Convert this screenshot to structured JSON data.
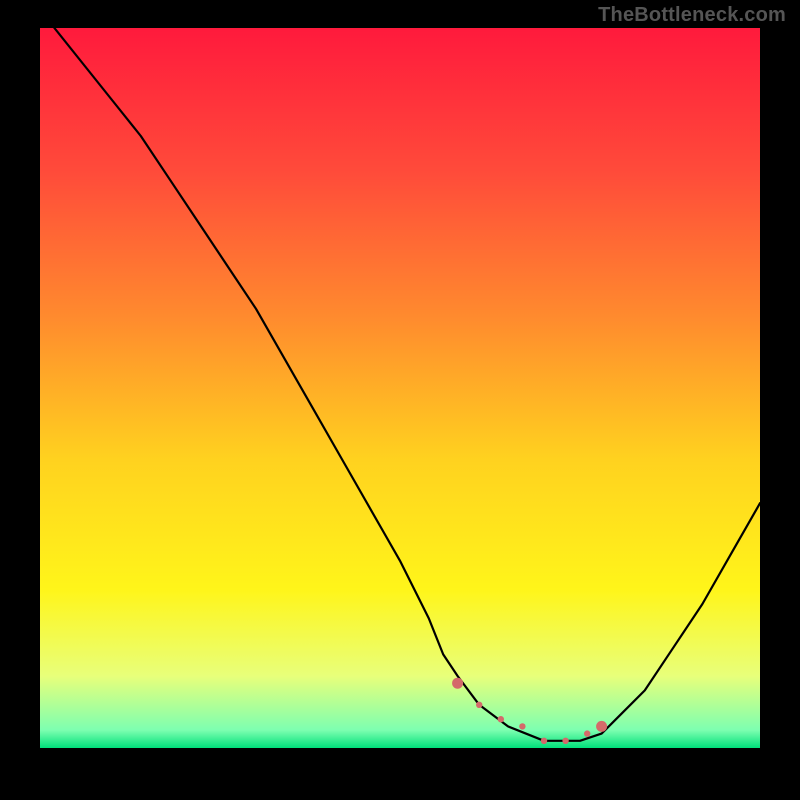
{
  "watermark": "TheBottleneck.com",
  "chart_data": {
    "type": "line",
    "title": "",
    "xlabel": "",
    "ylabel": "",
    "xlim": [
      0,
      100
    ],
    "ylim": [
      0,
      100
    ],
    "grid": false,
    "legend": false,
    "background_gradient": {
      "stops": [
        {
          "offset": 0.0,
          "color": "#ff1a3c"
        },
        {
          "offset": 0.2,
          "color": "#ff4b3a"
        },
        {
          "offset": 0.4,
          "color": "#ff8a2e"
        },
        {
          "offset": 0.6,
          "color": "#ffd21f"
        },
        {
          "offset": 0.78,
          "color": "#fff51a"
        },
        {
          "offset": 0.9,
          "color": "#e8ff7a"
        },
        {
          "offset": 0.975,
          "color": "#7dffb0"
        },
        {
          "offset": 1.0,
          "color": "#00e07a"
        }
      ]
    },
    "series": [
      {
        "name": "bottleneck-curve",
        "x": [
          2,
          6,
          10,
          14,
          18,
          22,
          26,
          30,
          34,
          38,
          42,
          46,
          50,
          54,
          56,
          58,
          61,
          65,
          70,
          75,
          78,
          80,
          84,
          88,
          92,
          96,
          100
        ],
        "values": [
          100,
          95,
          90,
          85,
          79,
          73,
          67,
          61,
          54,
          47,
          40,
          33,
          26,
          18,
          13,
          10,
          6,
          3,
          1,
          1,
          2,
          4,
          8,
          14,
          20,
          27,
          34
        ]
      }
    ],
    "markers": {
      "name": "highlight-points",
      "color": "#d46a6a",
      "x": [
        58,
        61,
        64,
        67,
        70,
        73,
        76,
        78
      ],
      "values": [
        9,
        6,
        4,
        3,
        1,
        1,
        2,
        3
      ]
    }
  }
}
